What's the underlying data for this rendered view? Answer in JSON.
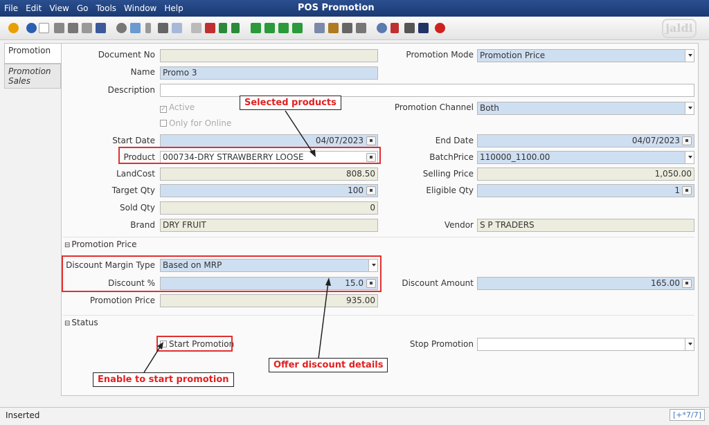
{
  "menu": {
    "items": [
      {
        "label": "File"
      },
      {
        "label": "Edit"
      },
      {
        "label": "View"
      },
      {
        "label": "Go"
      },
      {
        "label": "Tools"
      },
      {
        "label": "Window"
      },
      {
        "label": "Help"
      }
    ],
    "title": "POS Promotion"
  },
  "toolbar": {
    "logo_text": "jaldi",
    "icons": [
      "undo-icon",
      "help-icon",
      "new-icon",
      "copy-icon",
      "delete-icon",
      "ignore-icon",
      "save-icon",
      "refresh-icon",
      "find-icon",
      "attachment-icon",
      "chat-icon",
      "history-icon",
      "home-icon",
      "menu-icon",
      "back-icon",
      "forward-icon",
      "first-icon",
      "previous-icon",
      "next-icon",
      "last-icon",
      "report-icon",
      "archive-icon",
      "print-icon",
      "print-preview-icon",
      "zoom-icon",
      "workflow-icon",
      "process-icon",
      "product-icon",
      "close-icon"
    ]
  },
  "tabs": [
    {
      "label": "Promotion"
    },
    {
      "label": "Promotion Sales"
    }
  ],
  "form": {
    "document_no": {
      "label": "Document No",
      "value": ""
    },
    "name": {
      "label": "Name",
      "value": "Promo 3"
    },
    "description": {
      "label": "Description",
      "value": ""
    },
    "active": {
      "label": "Active",
      "checked": true
    },
    "only_online": {
      "label": "Only for Online",
      "checked": false
    },
    "start_date": {
      "label": "Start Date",
      "value": "04/07/2023"
    },
    "end_date": {
      "label": "End Date",
      "value": "04/07/2023"
    },
    "product": {
      "label": "Product",
      "value": "000734-DRY STRAWBERRY LOOSE"
    },
    "batch_price": {
      "label": "BatchPrice",
      "value": "110000_1100.00"
    },
    "land_cost": {
      "label": "LandCost",
      "value": "808.50"
    },
    "selling_price": {
      "label": "Selling Price",
      "value": "1,050.00"
    },
    "target_qty": {
      "label": "Target Qty",
      "value": "100"
    },
    "eligible_qty": {
      "label": "Eligible Qty",
      "value": "1"
    },
    "sold_qty": {
      "label": "Sold Qty",
      "value": "0"
    },
    "brand": {
      "label": "Brand",
      "value": "DRY FRUIT"
    },
    "vendor": {
      "label": "Vendor",
      "value": "S P TRADERS"
    },
    "promotion_mode": {
      "label": "Promotion Mode",
      "value": "Promotion Price"
    },
    "promotion_channel": {
      "label": "Promotion Channel",
      "value": "Both"
    },
    "section_price": "Promotion Price",
    "discount_margin_type": {
      "label": "Discount Margin Type",
      "value": "Based on MRP"
    },
    "discount_pct": {
      "label": "Discount %",
      "value": "15.0"
    },
    "discount_amount": {
      "label": "Discount Amount",
      "value": "165.00"
    },
    "promotion_price": {
      "label": "Promotion Price",
      "value": "935.00"
    },
    "section_status": "Status",
    "start_promotion": {
      "label": "Start Promotion",
      "checked": false
    },
    "stop_promotion": {
      "label": "Stop Promotion",
      "value": ""
    }
  },
  "callouts": {
    "selected_products": "Selected products",
    "offer_discount": "Offer discount details",
    "enable_start": "Enable to start promotion"
  },
  "status": {
    "text": "Inserted",
    "record": "[+*7/7]"
  },
  "colors": {
    "title_bar": "#1b3a72",
    "mandatory_field": "#cfdff2",
    "readonly_field": "#ededdf",
    "annotation_red": "#e02020"
  }
}
